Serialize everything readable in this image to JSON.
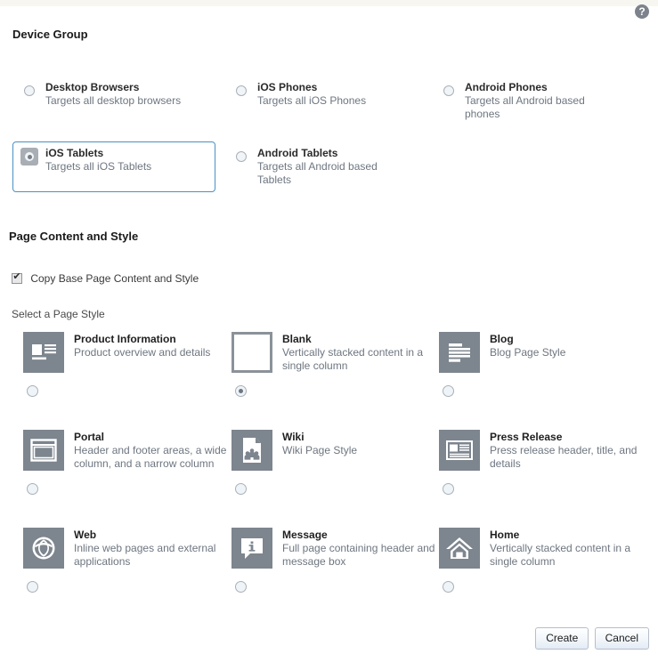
{
  "help": {
    "icon": "help-icon",
    "label": "?"
  },
  "device_group": {
    "title": "Device Group",
    "options": [
      {
        "label": "Desktop Browsers",
        "desc": "Targets all desktop browsers",
        "selected": false
      },
      {
        "label": "iOS Phones",
        "desc": "Targets all iOS Phones",
        "selected": false
      },
      {
        "label": "Android Phones",
        "desc": "Targets all Android based phones",
        "selected": false
      },
      {
        "label": "iOS Tablets",
        "desc": "Targets all iOS Tablets",
        "selected": true
      },
      {
        "label": "Android Tablets",
        "desc": "Targets all Android based Tablets",
        "selected": false
      }
    ]
  },
  "page_content": {
    "title": "Page Content and Style",
    "copy_base_label": "Copy Base Page Content and Style",
    "copy_base_checked": true,
    "select_style_label": "Select a Page Style",
    "styles": [
      {
        "name": "Product Information",
        "desc": "Product overview and details",
        "icon": "product-information-icon",
        "selected": false
      },
      {
        "name": "Blank",
        "desc": "Vertically stacked content in a single column",
        "icon": "blank-page-icon",
        "selected": true
      },
      {
        "name": "Blog",
        "desc": "Blog Page Style",
        "icon": "blog-icon",
        "selected": false
      },
      {
        "name": "Portal",
        "desc": "Header and footer areas, a wide column, and a narrow column",
        "icon": "portal-icon",
        "selected": false
      },
      {
        "name": "Wiki",
        "desc": "Wiki Page Style",
        "icon": "wiki-icon",
        "selected": false
      },
      {
        "name": "Press Release",
        "desc": "Press release header, title, and details",
        "icon": "press-release-icon",
        "selected": false
      },
      {
        "name": "Web",
        "desc": "Inline web pages and external applications",
        "icon": "web-icon",
        "selected": false
      },
      {
        "name": "Message",
        "desc": "Full page containing header and message box",
        "icon": "message-icon",
        "selected": false
      },
      {
        "name": "Home",
        "desc": "Vertically stacked content in a single column",
        "icon": "home-icon",
        "selected": false
      }
    ]
  },
  "footer": {
    "create_label": "Create",
    "cancel_label": "Cancel"
  },
  "colors": {
    "accent_border": "#4a90c4",
    "icon_tile": "#7d858e",
    "text_primary": "#1f1f1f",
    "text_secondary": "#6e7680",
    "top_band": "#f7f6f0"
  }
}
